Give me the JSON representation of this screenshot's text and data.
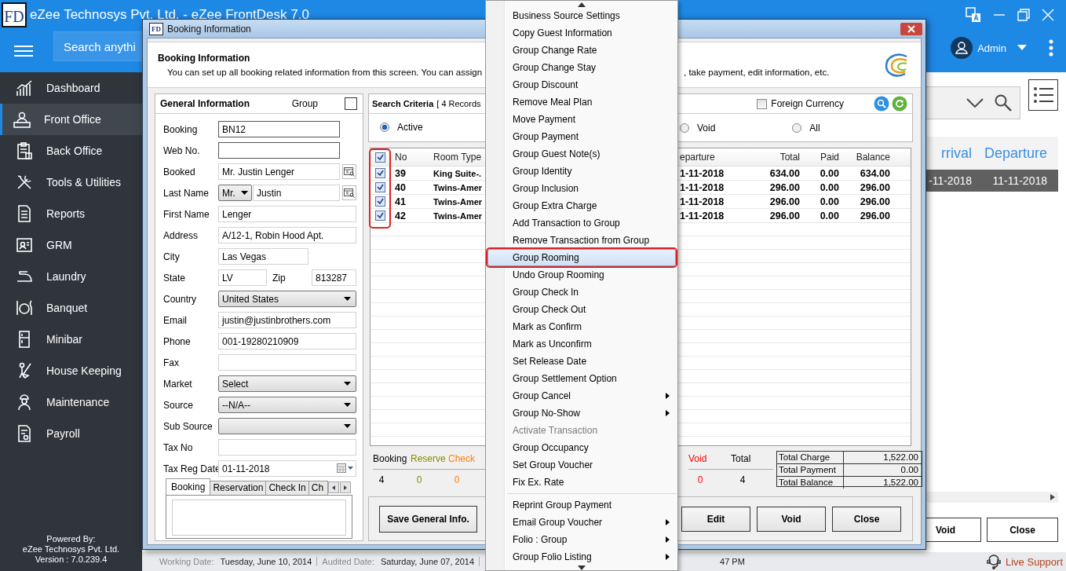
{
  "app": {
    "logo": "FD",
    "title": "eZee Technosys Pvt. Ltd. - eZee FrontDesk 7.0",
    "search": {
      "placeholder": "Search anythi"
    },
    "user": "Admin"
  },
  "sidebar": {
    "items": [
      {
        "label": "Dashboard",
        "selected": false
      },
      {
        "label": "Front Office",
        "selected": true
      },
      {
        "label": "Back Office",
        "selected": false
      },
      {
        "label": "Tools & Utilities",
        "selected": false
      },
      {
        "label": "Reports",
        "selected": false
      },
      {
        "label": "GRM",
        "selected": false
      },
      {
        "label": "Laundry",
        "selected": false
      },
      {
        "label": "Banquet",
        "selected": false
      },
      {
        "label": "Minibar",
        "selected": false
      },
      {
        "label": "House Keeping",
        "selected": false
      },
      {
        "label": "Maintenance",
        "selected": false
      },
      {
        "label": "Payroll",
        "selected": false
      }
    ],
    "footer": [
      "Powered By:",
      "eZee Technosys Pvt. Ltd.",
      "Version : 7.0.239.4"
    ]
  },
  "main": {
    "table": {
      "columns": [
        "rrival",
        "Departure"
      ],
      "rows": [
        {
          "cells": [
            "-11-2018",
            "11-11-2018"
          ],
          "selected": true
        }
      ]
    },
    "buttons": [
      "Void",
      "Close"
    ]
  },
  "status_bar": {
    "items": [
      {
        "label": "Working Date:",
        "value": "Tuesday, June 10, 2014"
      },
      {
        "label": "Audited Date:",
        "value": "Saturday, June 07, 2014"
      }
    ],
    "time": "47 PM",
    "support": "Live Support"
  },
  "dialog": {
    "title": "Booking Information",
    "icon": "FD",
    "header": {
      "title": "Booking Information",
      "description": [
        "You can set up all booking related information from this screen. You can assign",
        ", take payment, edit information, etc."
      ]
    },
    "general": {
      "title": "General Information",
      "group_label": "Group",
      "group_checked": false,
      "fields": [
        {
          "label": "Booking",
          "kind": "code",
          "value": "BN12"
        },
        {
          "label": "Web No.",
          "kind": "code"
        },
        {
          "label": "Booked",
          "kind": "lookup",
          "value": "Mr. Justin Lenger"
        },
        {
          "label": "Last Name",
          "kind": "title_lookup",
          "prefix": "Mr.",
          "value": "Justin"
        },
        {
          "label": "First Name",
          "kind": "text",
          "value": "Lenger"
        },
        {
          "label": "Address",
          "kind": "text",
          "value": "A/12-1, Robin Hood Apt."
        },
        {
          "label": "City",
          "kind": "short",
          "value": "Las Vegas"
        },
        {
          "label": "State",
          "kind": "pair",
          "value": "LV",
          "second_label": "Zip",
          "second_value": "813287"
        },
        {
          "label": "Country",
          "kind": "select",
          "value": "United States"
        },
        {
          "label": "Email",
          "kind": "text",
          "value": "justin@justinbrothers.com"
        },
        {
          "label": "Phone",
          "kind": "text",
          "value": "001-19280210909"
        },
        {
          "label": "Fax",
          "kind": "text"
        },
        {
          "label": "Market",
          "kind": "select",
          "value": "Select"
        },
        {
          "label": "Source",
          "kind": "select",
          "value": "--N/A--"
        },
        {
          "label": "Sub Source",
          "kind": "select"
        },
        {
          "label": "Tax No",
          "kind": "text"
        },
        {
          "label": "Tax Reg Date",
          "kind": "date",
          "value": "01-11-2018"
        }
      ],
      "tabs": [
        {
          "label": "Booking",
          "selected": true
        },
        {
          "label": "Reservation",
          "selected": false
        },
        {
          "label": "Check In",
          "selected": false
        },
        {
          "label": "Ch",
          "selected": false
        }
      ]
    },
    "search": {
      "title": "Search Criteria",
      "records": "[ 4 Records",
      "foreign_currency": {
        "label": "Foreign Currency",
        "checked": false
      },
      "filters_left": [
        {
          "label": "Active",
          "selected": true
        }
      ],
      "filters_right": [
        {
          "label": "Void",
          "selected": false
        },
        {
          "label": "All",
          "selected": false
        }
      ]
    },
    "bookings": {
      "all_checked": true,
      "columns": [
        "No",
        "Room Type",
        "eparture",
        "Total",
        "Paid",
        "Balance"
      ],
      "rows": [
        {
          "checked": true,
          "no": "39",
          "room_type": "King Suite-.",
          "departure": "1-11-2018",
          "total": "634.00",
          "paid": "0.00",
          "balance": "634.00"
        },
        {
          "checked": true,
          "no": "40",
          "room_type": "Twins-Amer",
          "departure": "1-11-2018",
          "total": "296.00",
          "paid": "0.00",
          "balance": "296.00"
        },
        {
          "checked": true,
          "no": "41",
          "room_type": "Twins-Amer",
          "departure": "1-11-2018",
          "total": "296.00",
          "paid": "0.00",
          "balance": "296.00"
        },
        {
          "checked": true,
          "no": "42",
          "room_type": "Twins-Amer",
          "departure": "1-11-2018",
          "total": "296.00",
          "paid": "0.00",
          "balance": "296.00"
        }
      ]
    },
    "counts": {
      "left": [
        {
          "label": "Booking",
          "value": "4",
          "color": "#000000"
        },
        {
          "label": "Reserve",
          "value": "0",
          "color": "#8a8a00"
        },
        {
          "label": "Check",
          "value": "0",
          "color": "#ff8000"
        }
      ],
      "right": [
        {
          "label": "Void",
          "value": "0",
          "color": "#ff0000"
        },
        {
          "label": "Total",
          "value": "4",
          "color": "#000000"
        }
      ]
    },
    "totals": [
      {
        "label": "Total Charge",
        "value": "1,522.00"
      },
      {
        "label": "Total Payment",
        "value": "0.00"
      },
      {
        "label": "Total Balance",
        "value": "1,522.00"
      }
    ],
    "buttons": {
      "left": [
        "Save General Info."
      ],
      "right": [
        "Edit",
        "Void",
        "Close"
      ]
    }
  },
  "context_menu": {
    "sections": [
      {
        "items": [
          {
            "label": "Business Source Settings",
            "selected": false,
            "disabled": false,
            "submenu": false
          },
          {
            "label": "Copy Guest Information",
            "selected": false,
            "disabled": false,
            "submenu": false
          },
          {
            "label": "Group Change Rate",
            "selected": false,
            "disabled": false,
            "submenu": false
          },
          {
            "label": "Group Change Stay",
            "selected": false,
            "disabled": false,
            "submenu": false
          },
          {
            "label": "Group Discount",
            "selected": false,
            "disabled": false,
            "submenu": false
          },
          {
            "label": "Remove Meal Plan",
            "selected": false,
            "disabled": false,
            "submenu": false
          },
          {
            "label": "Move Payment",
            "selected": false,
            "disabled": false,
            "submenu": false
          },
          {
            "label": "Group Payment",
            "selected": false,
            "disabled": false,
            "submenu": false
          },
          {
            "label": "Group Guest Note(s)",
            "selected": false,
            "disabled": false,
            "submenu": false
          },
          {
            "label": "Group Identity",
            "selected": false,
            "disabled": false,
            "submenu": false
          },
          {
            "label": "Group Inclusion",
            "selected": false,
            "disabled": false,
            "submenu": false
          },
          {
            "label": "Group Extra Charge",
            "selected": false,
            "disabled": false,
            "submenu": false
          },
          {
            "label": "Add Transaction to Group",
            "selected": false,
            "disabled": false,
            "submenu": false
          },
          {
            "label": "Remove Transaction from Group",
            "selected": false,
            "disabled": false,
            "submenu": false
          },
          {
            "label": "Group Rooming",
            "selected": true,
            "disabled": false,
            "submenu": false
          },
          {
            "label": "Undo Group Rooming",
            "selected": false,
            "disabled": false,
            "submenu": false
          },
          {
            "label": "Group Check In",
            "selected": false,
            "disabled": false,
            "submenu": false
          },
          {
            "label": "Group Check Out",
            "selected": false,
            "disabled": false,
            "submenu": false
          },
          {
            "label": "Mark as Confirm",
            "selected": false,
            "disabled": false,
            "submenu": false
          },
          {
            "label": "Mark as Unconfirm",
            "selected": false,
            "disabled": false,
            "submenu": false
          },
          {
            "label": "Set Release Date",
            "selected": false,
            "disabled": false,
            "submenu": false
          },
          {
            "label": "Group Settlement Option",
            "selected": false,
            "disabled": false,
            "submenu": false
          },
          {
            "label": "Group Cancel",
            "selected": false,
            "disabled": false,
            "submenu": true
          },
          {
            "label": "Group No-Show",
            "selected": false,
            "disabled": false,
            "submenu": true
          },
          {
            "label": "Activate Transaction",
            "selected": false,
            "disabled": true,
            "submenu": false
          },
          {
            "label": "Group Occupancy",
            "selected": false,
            "disabled": false,
            "submenu": false
          },
          {
            "label": "Set Group Voucher",
            "selected": false,
            "disabled": false,
            "submenu": false
          },
          {
            "label": "Fix Ex. Rate",
            "selected": false,
            "disabled": false,
            "submenu": false
          }
        ]
      },
      {
        "items": [
          {
            "label": "Reprint Group Payment",
            "selected": false,
            "disabled": false,
            "submenu": false
          },
          {
            "label": "Email Group Voucher",
            "selected": false,
            "disabled": false,
            "submenu": true
          },
          {
            "label": "Folio : Group",
            "selected": false,
            "disabled": false,
            "submenu": true
          },
          {
            "label": "Group Folio Listing",
            "selected": false,
            "disabled": false,
            "submenu": true
          }
        ]
      }
    ]
  }
}
